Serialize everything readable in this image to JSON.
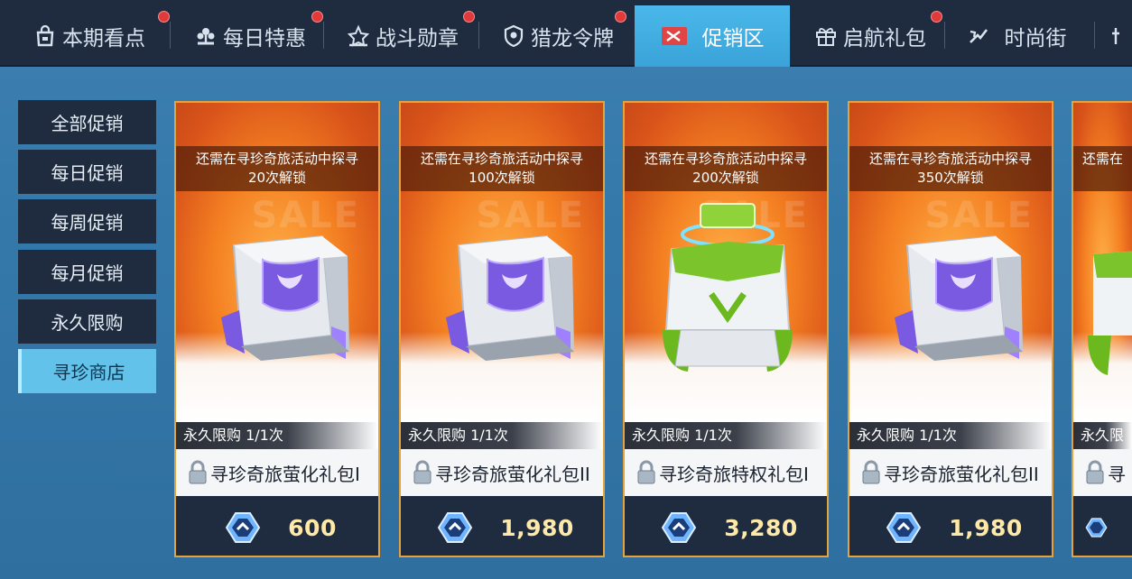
{
  "tabs": [
    {
      "label": "本期看点",
      "icon": "bag-icon",
      "has_dot": true
    },
    {
      "label": "每日特惠",
      "icon": "flower-icon",
      "has_dot": true
    },
    {
      "label": "战斗勋章",
      "icon": "medal-icon",
      "has_dot": true
    },
    {
      "label": "猎龙令牌",
      "icon": "badge-icon",
      "has_dot": true
    },
    {
      "label": "促销区",
      "icon": "sale-tag-icon",
      "has_dot": false,
      "active": true
    },
    {
      "label": "启航礼包",
      "icon": "gift-icon",
      "has_dot": true
    },
    {
      "label": "时尚街",
      "icon": "fashion-icon",
      "has_dot": false
    }
  ],
  "side_menu": [
    {
      "label": "全部促销"
    },
    {
      "label": "每日促销"
    },
    {
      "label": "每周促销"
    },
    {
      "label": "每月促销"
    },
    {
      "label": "永久限购"
    },
    {
      "label": "寻珍商店",
      "active": true
    }
  ],
  "cards": [
    {
      "unlock_line1": "还需在寻珍奇旅活动中探寻",
      "unlock_line2": "20次解锁",
      "sale_text": "SALE",
      "limit": "永久限购 1/1次",
      "name": "寻珍奇旅萤化礼包I",
      "price": "600",
      "box_style": "purple"
    },
    {
      "unlock_line1": "还需在寻珍奇旅活动中探寻",
      "unlock_line2": "100次解锁",
      "sale_text": "SALE",
      "limit": "永久限购 1/1次",
      "name": "寻珍奇旅萤化礼包II",
      "price": "1,980",
      "box_style": "purple"
    },
    {
      "unlock_line1": "还需在寻珍奇旅活动中探寻",
      "unlock_line2": "200次解锁",
      "sale_text": "SALE",
      "limit": "永久限购 1/1次",
      "name": "寻珍奇旅特权礼包I",
      "price": "3,280",
      "box_style": "green"
    },
    {
      "unlock_line1": "还需在寻珍奇旅活动中探寻",
      "unlock_line2": "350次解锁",
      "sale_text": "SALE",
      "limit": "永久限购 1/1次",
      "name": "寻珍奇旅萤化礼包II",
      "price": "1,980",
      "box_style": "purple"
    },
    {
      "unlock_line1": "还需在",
      "unlock_line2": "",
      "sale_text": "",
      "limit": "永久限",
      "name": "寻",
      "price": "",
      "box_style": "green"
    }
  ],
  "colors": {
    "tab_bar_bg": "#1f2c40",
    "tab_active_bg": "#3aa3d9",
    "notification_dot": "#e03a3a",
    "card_border": "#e8a23c",
    "price_text": "#ffe9a8",
    "page_bg": "#3478aa"
  }
}
